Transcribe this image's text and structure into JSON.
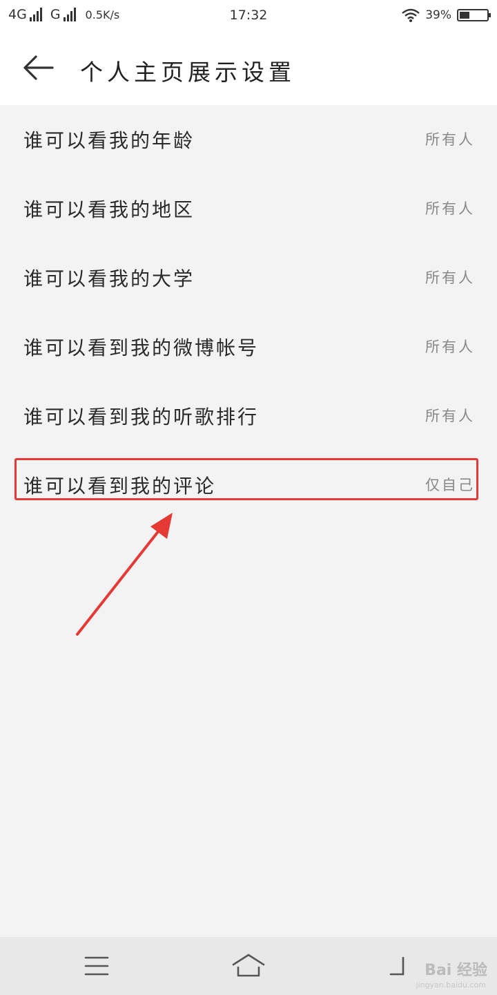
{
  "status_bar": {
    "network1": "4G",
    "network2": "G",
    "speed": "0.5K/s",
    "time": "17:32",
    "battery": "39%"
  },
  "header": {
    "title": "个人主页展示设置",
    "back_icon": "back-arrow-icon"
  },
  "settings": [
    {
      "label": "谁可以看我的年龄",
      "value": "所有人"
    },
    {
      "label": "谁可以看我的地区",
      "value": "所有人"
    },
    {
      "label": "谁可以看我的大学",
      "value": "所有人"
    },
    {
      "label": "谁可以看到我的微博帐号",
      "value": "所有人"
    },
    {
      "label": "谁可以看到我的听歌排行",
      "value": "所有人"
    },
    {
      "label": "谁可以看到我的评论",
      "value": "仅自己"
    }
  ],
  "annotation": {
    "highlight_color": "#e53935",
    "highlighted_item": "谁可以看到我的评论"
  },
  "nav_bar": {
    "icons": [
      "menu-icon",
      "home-icon",
      "back-icon"
    ]
  },
  "watermark": {
    "text": "Bai 经验",
    "sub": "jingyan.baidu.com"
  }
}
